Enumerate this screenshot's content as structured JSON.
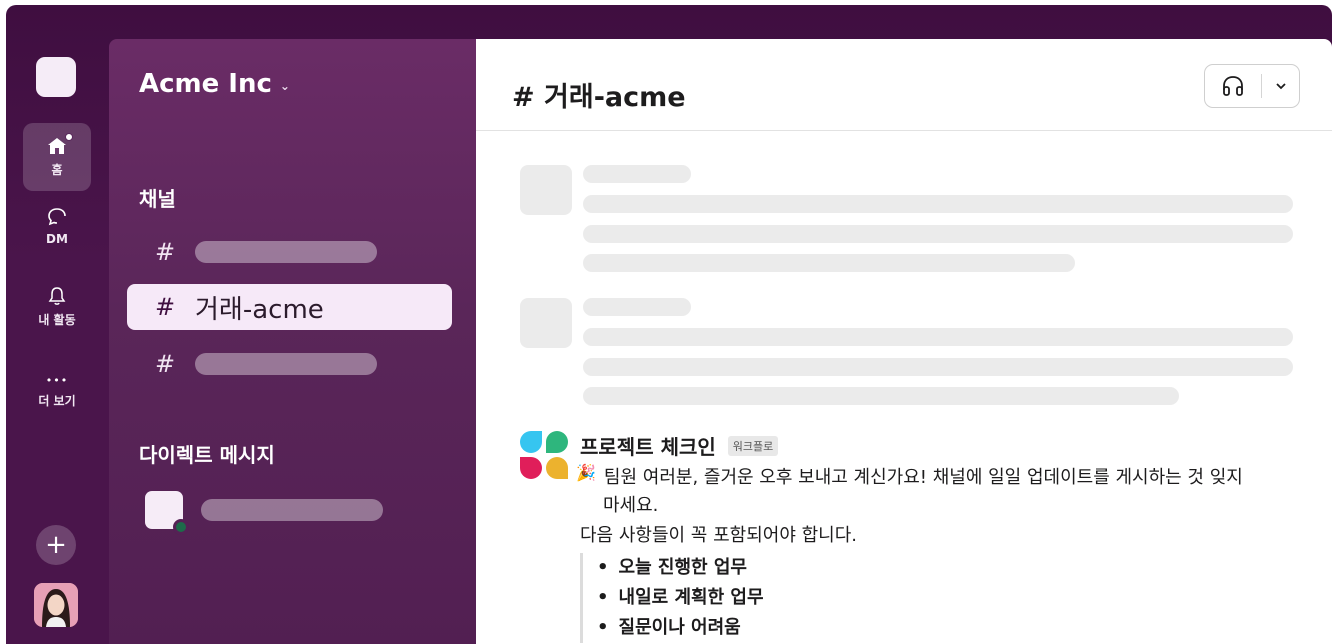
{
  "rail": {
    "home_label": "홈",
    "dm_label": "DM",
    "activity_label": "내 활동",
    "more_label": "더 보기",
    "more_dots": "•••",
    "add_symbol": "+"
  },
  "sidebar": {
    "workspace_name": "Acme Inc",
    "workspace_chevron": "⌄",
    "channels_title": "채널",
    "channels": [
      {
        "hash": "#",
        "name": ""
      },
      {
        "hash": "#",
        "name": "거래-acme"
      },
      {
        "hash": "#",
        "name": ""
      }
    ],
    "dm_title": "다이렉트 메시지"
  },
  "main": {
    "channel_title": "# 거래-acme",
    "message": {
      "title": "프로젝트 체크인",
      "badge": "워크플로",
      "emoji": "🎉",
      "line1": "팀원 여러분, 즐거운 오후 보내고 계신가요! 채널에 일일 업데이트를 게시하는 것 잊지",
      "line1_cont": "마세요.",
      "line2": "다음 사항들이 꼭 포함되어야 합니다.",
      "bullets": [
        "오늘 진행한 업무",
        "내일로 계획한 업무",
        "질문이나 어려움"
      ]
    }
  },
  "colors": {
    "aubergine": "#4a154b",
    "blob_blue": "#36c5f0",
    "blob_green": "#2eb67d",
    "blob_red": "#e01e5a",
    "blob_yellow": "#ecb22e"
  }
}
